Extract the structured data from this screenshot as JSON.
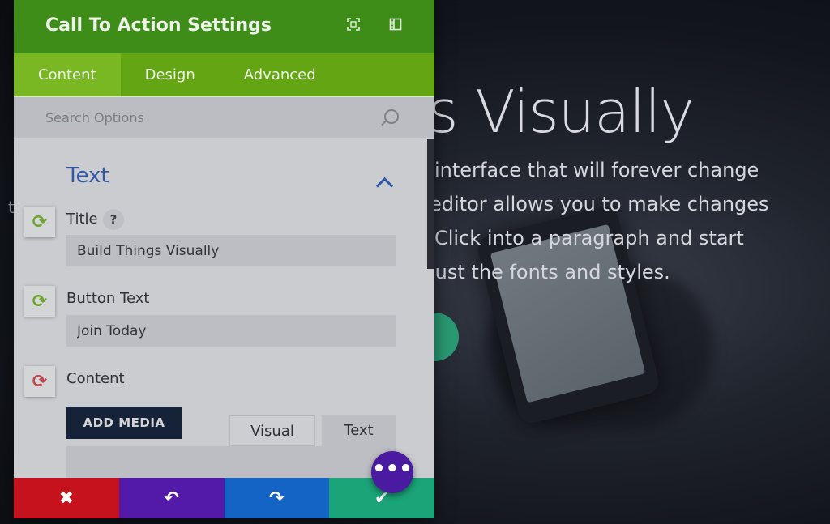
{
  "background": {
    "heading": "s Visually",
    "paragraph_lines": [
      "interface that will forever change",
      "editor allows you to make changes",
      "Click into a paragraph and start",
      "just the fonts and styles."
    ],
    "stray_char": "t"
  },
  "panel": {
    "title": "Call To Action Settings",
    "tabs": [
      {
        "label": "Content",
        "active": true
      },
      {
        "label": "Design",
        "active": false
      },
      {
        "label": "Advanced",
        "active": false
      }
    ],
    "search": {
      "placeholder": "Search Options"
    },
    "section_title": "Text",
    "fields": {
      "title": {
        "label": "Title",
        "value": "Build Things Visually",
        "help": "?"
      },
      "button_text": {
        "label": "Button Text",
        "value": "Join Today"
      },
      "content": {
        "label": "Content"
      }
    },
    "editor": {
      "add_media_label": "ADD MEDIA",
      "visual_tab": "Visual",
      "text_tab": "Text"
    },
    "footer": {
      "cancel": "✖",
      "undo": "↶",
      "redo": "↷",
      "save": "✔"
    },
    "fab": "•••"
  },
  "colors": {
    "header": "#3f8d19",
    "tabs_bar": "#64a513",
    "section_title": "#2e5fc0",
    "cancel": "#c5121c",
    "undo": "#5319a8",
    "redo": "#1364c4",
    "save": "#1aa477"
  },
  "icons": {
    "header_left": "focus-icon",
    "header_right": "sidebar-layout-icon",
    "search": "search-icon",
    "collapse": "chevron-up-icon",
    "sync": "sync-icon"
  }
}
